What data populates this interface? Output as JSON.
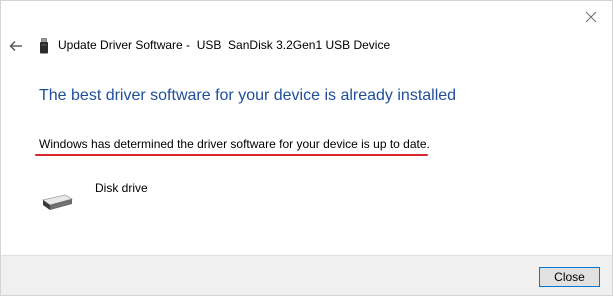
{
  "window": {
    "title": "Update Driver Software -  USB  SanDisk 3.2Gen1 USB Device"
  },
  "main": {
    "heading": "The best driver software for your device is already installed",
    "status": "Windows has determined the driver software for your device is up to date.",
    "device": {
      "label": "Disk drive",
      "icon": "disk-drive-icon"
    }
  },
  "footer": {
    "close_label": "Close"
  },
  "icons": {
    "back": "back-arrow-icon",
    "window_close": "close-icon",
    "usb": "usb-drive-icon"
  },
  "colors": {
    "heading": "#1f4e9b",
    "underline": "#d9262b",
    "button_border": "#0078d7",
    "footer_bg": "#f0f0f0"
  }
}
